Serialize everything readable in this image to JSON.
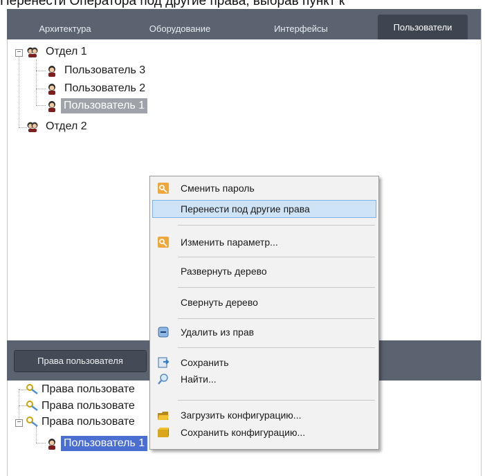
{
  "caption": "Перенести Оператора под другие права, выбрав пункт к",
  "top_tabs": [
    "Архитектура",
    "Оборудование",
    "Интерфейсы",
    "Пользователи"
  ],
  "active_tab_index": 3,
  "user_tree": {
    "groups": [
      {
        "label": "Отдел 1",
        "expanded": true,
        "users": [
          "Пользователь 3",
          "Пользователь 2",
          "Пользователь 1"
        ],
        "selected_user": "Пользователь 1"
      },
      {
        "label": "Отдел 2",
        "expanded": false,
        "users": []
      }
    ]
  },
  "rights_panel": {
    "tab_label": "Права пользователя",
    "items": [
      "Права пользовате",
      "Права пользовате",
      "Права пользовате"
    ],
    "child_user": "Пользователь 1"
  },
  "context_menu": {
    "items": [
      {
        "label": "Сменить пароль",
        "icon": "key-icon"
      },
      {
        "label": "Перенести под другие права",
        "icon": "",
        "highlighted": true
      },
      {
        "label": "Изменить параметр...",
        "icon": "key-icon"
      },
      {
        "label": "Развернуть дерево",
        "icon": ""
      },
      {
        "label": "Свернуть дерево",
        "icon": ""
      },
      {
        "label": "Удалить из прав",
        "icon": "remove-icon"
      },
      {
        "label": "Сохранить",
        "icon": "save-icon"
      },
      {
        "label": "Найти...",
        "icon": "search-icon"
      },
      {
        "label": "Загрузить конфигурацию...",
        "icon": "folder-open-icon"
      },
      {
        "label": "Сохранить конфигурацию...",
        "icon": "folder-icon"
      }
    ]
  },
  "colors": {
    "tab_bar": "#5b6270",
    "selection": "#9fa3a9",
    "menu_highlight": "#cfe3f7"
  }
}
